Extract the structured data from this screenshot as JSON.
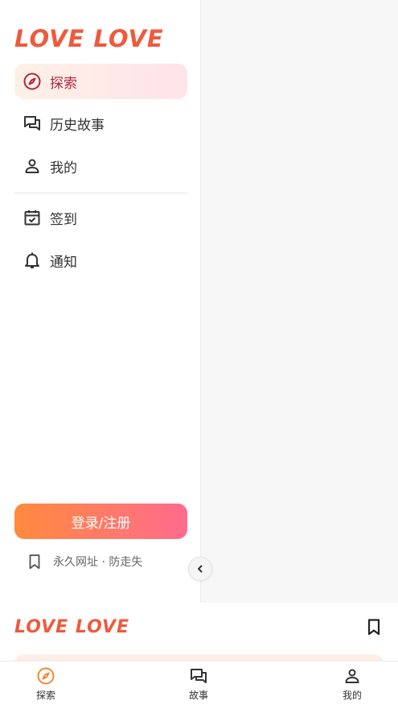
{
  "brand": {
    "logo_text": "LOVE LOVE",
    "logo_color": "#ee5a3e"
  },
  "sidebar": {
    "nav": [
      {
        "label": "探索",
        "icon": "compass-icon",
        "active": true
      },
      {
        "label": "历史故事",
        "icon": "chat-bubbles-icon",
        "active": false
      },
      {
        "label": "我的",
        "icon": "user-icon",
        "active": false
      }
    ],
    "secondary": [
      {
        "label": "签到",
        "icon": "calendar-check-icon"
      },
      {
        "label": "通知",
        "icon": "bell-icon"
      }
    ],
    "login_label": "登录/注册",
    "bookmark_label": "永久网址 · 防走失"
  },
  "bottom_nav": [
    {
      "label": "探索",
      "icon": "compass-icon",
      "active": true
    },
    {
      "label": "故事",
      "icon": "chat-bubbles-icon",
      "active": false
    },
    {
      "label": "我的",
      "icon": "user-icon",
      "active": false
    }
  ],
  "colors": {
    "accent": "#b0283f",
    "gradient_start": "#ff8a3d",
    "gradient_end": "#ff6b8e"
  }
}
